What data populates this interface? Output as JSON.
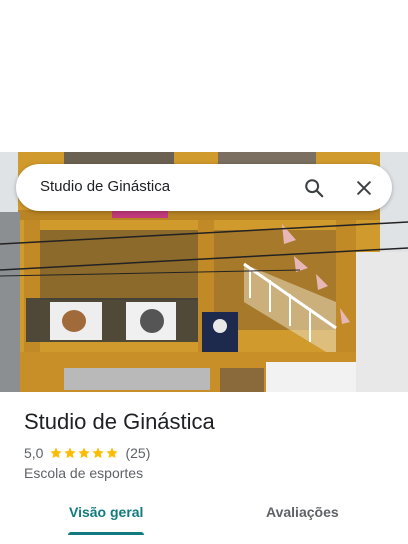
{
  "search": {
    "query": "Studio de Ginástica"
  },
  "icons": {
    "search": "search-icon",
    "close": "close-icon",
    "star": "star-icon"
  },
  "place": {
    "name": "Studio de Ginástica",
    "rating_text": "5,0",
    "rating_value": 5.0,
    "review_count_text": "(25)",
    "category": "Escola de esportes"
  },
  "tabs": [
    {
      "label": "Visão geral",
      "active": true
    },
    {
      "label": "Avaliações",
      "active": false
    }
  ],
  "colors": {
    "accent": "#137b7f",
    "star": "#fbbc04",
    "text": "#202124",
    "secondary": "#5f6368"
  }
}
